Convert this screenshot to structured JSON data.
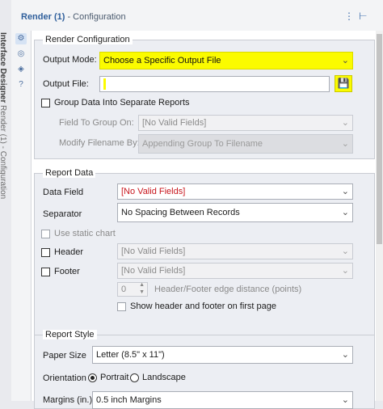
{
  "rail": {
    "bold": "Interface Designer",
    "rest": "Render (1) - Configuration"
  },
  "header": {
    "title_bold": "Render (1)",
    "title_rest": " - Configuration",
    "menu_icon": "menu-icon",
    "pin_icon": "pin-icon"
  },
  "iconbar": {
    "items": [
      "gear-icon",
      "target-icon",
      "tag-icon",
      "help-icon"
    ]
  },
  "render_configuration": {
    "title": "Render Configuration",
    "output_mode_label": "Output Mode:",
    "output_mode_value": "Choose a Specific Output File",
    "output_file_label": "Output File:",
    "output_file_value": "",
    "group_data_label": "Group Data Into Separate Reports",
    "field_to_group_label": "Field To Group On:",
    "field_to_group_value": "[No Valid Fields]",
    "modify_filename_label": "Modify Filename By:",
    "modify_filename_value": "Appending Group To Filename"
  },
  "report_data": {
    "title": "Report Data",
    "data_field_label": "Data Field",
    "data_field_value": "[No Valid Fields]",
    "separator_label": "Separator",
    "separator_value": "No Spacing Between Records",
    "static_chart_label": "Use static chart",
    "header_label": "Header",
    "header_value": "[No Valid Fields]",
    "footer_label": "Footer",
    "footer_value": "[No Valid Fields]",
    "edge_distance_value": "0",
    "edge_distance_label": "Header/Footer edge distance (points)",
    "show_first_page_label": "Show header and footer on first page"
  },
  "report_style": {
    "title": "Report Style",
    "paper_size_label": "Paper Size",
    "paper_size_value": "Letter (8.5\" x 11\")",
    "orientation_label": "Orientation",
    "portrait_label": "Portrait",
    "landscape_label": "Landscape",
    "margins_label": "Margins (in.)",
    "margins_value": "0.5 inch Margins"
  },
  "colors": {
    "highlight": "#fbfb00",
    "accent": "#3f6fad",
    "error_text": "#c8161d"
  }
}
